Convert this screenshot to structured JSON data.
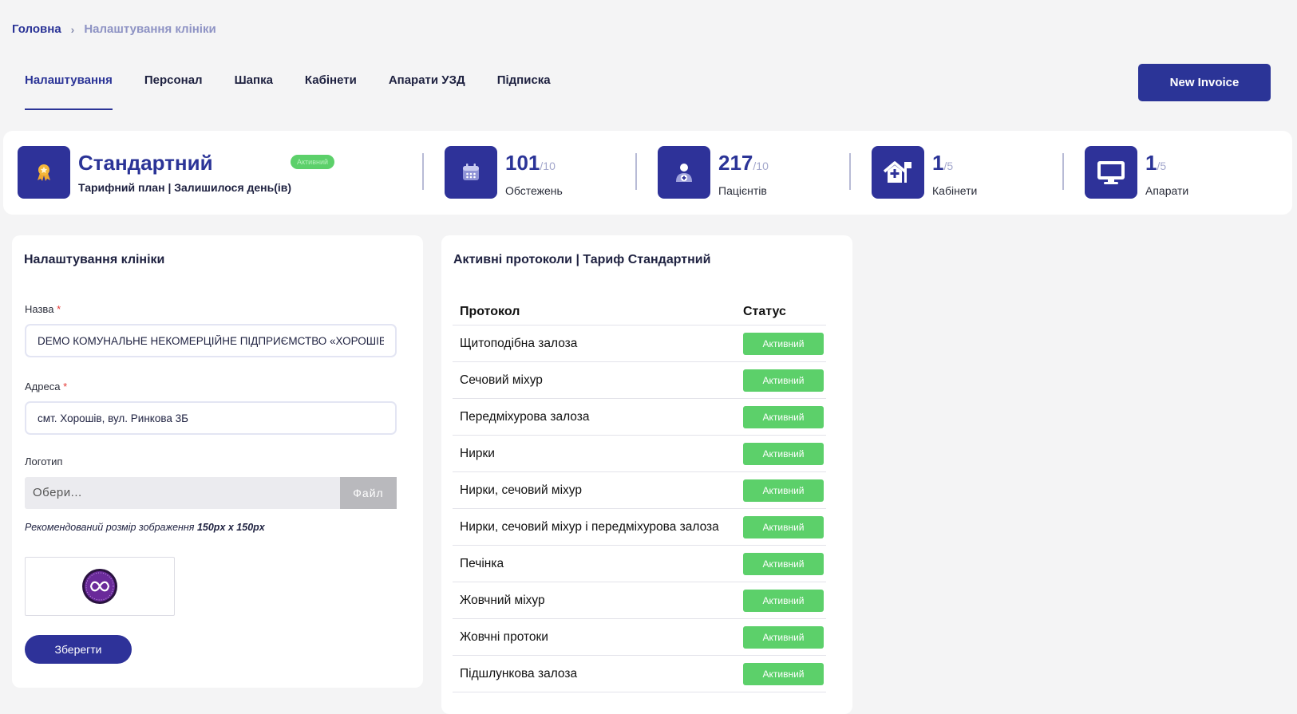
{
  "breadcrumb": {
    "home": "Головна",
    "current": "Налаштування клініки"
  },
  "tabs": [
    {
      "label": "Налаштування",
      "active": true
    },
    {
      "label": "Персонал"
    },
    {
      "label": "Шапка"
    },
    {
      "label": "Кабінети"
    },
    {
      "label": "Апарати УЗД"
    },
    {
      "label": "Підписка"
    }
  ],
  "new_invoice_label": "New Invoice",
  "plan": {
    "name": "Стандартний",
    "badge": "Активний",
    "subtitle": "Тарифний план | Залишилося день(ів)"
  },
  "stats": [
    {
      "value": "101",
      "max": "/10",
      "label": "Обстежень",
      "icon": "calendar-icon"
    },
    {
      "value": "217",
      "max": "/10",
      "label": "Пацієнтів",
      "icon": "patient-icon"
    },
    {
      "value": "1",
      "max": "/5",
      "label": "Кабінети",
      "icon": "clinic-icon"
    },
    {
      "value": "1",
      "max": "/5",
      "label": "Апарати",
      "icon": "monitor-icon"
    }
  ],
  "settings": {
    "title": "Налаштування клініки",
    "name_label": "Назва",
    "name_value": "DEMO КОМУНАЛЬНЕ НЕКОМЕРЦІЙНЕ ПІДПРИЄМСТВО «ХОРОШІВСЬКА",
    "address_label": "Адреса",
    "address_value": "смт. Хорошів, вул. Ринкова 3Б",
    "required_mark": "*",
    "logo_label": "Логотип",
    "file_placeholder": "Обери...",
    "file_button": "Файл",
    "hint_text": "Рекомендований розмір зображення ",
    "hint_size": "150px x 150px",
    "save_label": "Зберегти"
  },
  "protocols": {
    "title": "Активні протоколи | Тариф Стандартний",
    "col_protocol": "Протокол",
    "col_status": "Статус",
    "status_label": "Активний",
    "rows": [
      "Щитоподібна залоза",
      "Сечовий міхур",
      "Передміхурова залоза",
      "Нирки",
      "Нирки, сечовий міхур",
      "Нирки, сечовий міхур і передміхурова залоза",
      "Печінка",
      "Жовчний міхур",
      "Жовчні протоки",
      "Підшлункова залоза"
    ]
  },
  "colors": {
    "primary": "#2b3497",
    "success": "#5cd06a",
    "background": "#f4f4f5"
  }
}
